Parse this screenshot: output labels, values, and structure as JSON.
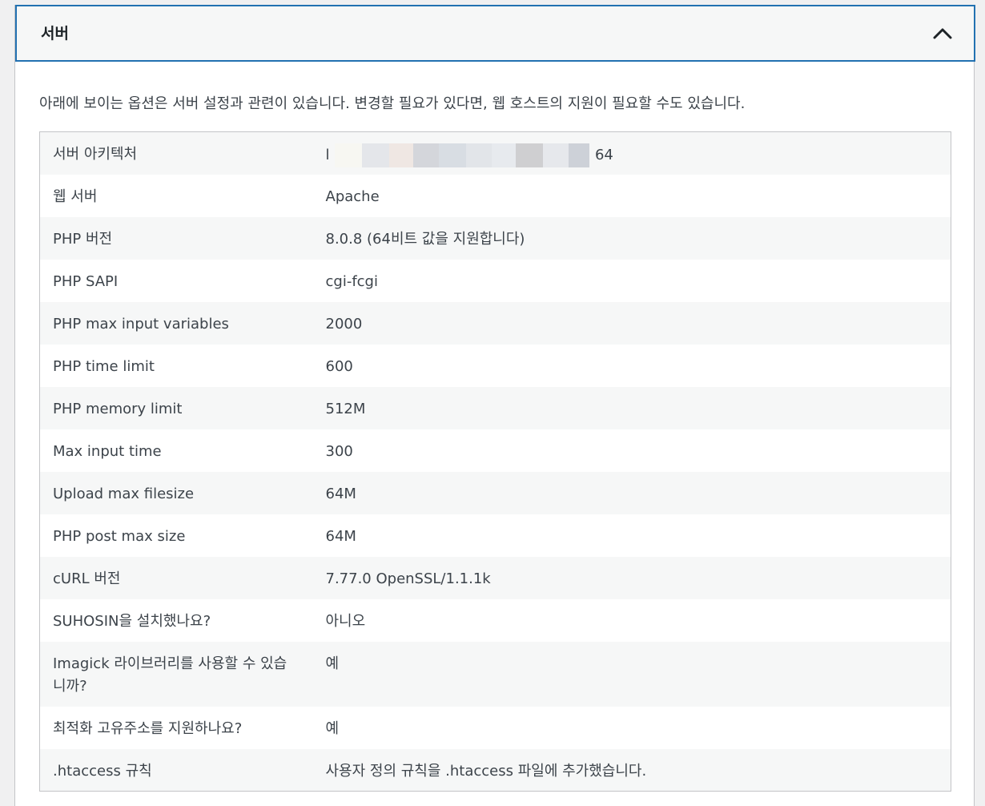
{
  "section": {
    "title": "서버",
    "description": "아래에 보이는 옵션은 서버 설정과 관련이 있습니다. 변경할 필요가 있다면, 웹 호스트의 지원이 필요할 수도 있습니다."
  },
  "rows": [
    {
      "label": "서버 아키텍처",
      "value_prefix": "l",
      "value_suffix": "64",
      "redacted": true
    },
    {
      "label": "웹 서버",
      "value": "Apache"
    },
    {
      "label": "PHP 버전",
      "value": "8.0.8 (64비트 값을 지원합니다)"
    },
    {
      "label": "PHP SAPI",
      "value": "cgi-fcgi"
    },
    {
      "label": "PHP max input variables",
      "value": "2000"
    },
    {
      "label": "PHP time limit",
      "value": "600"
    },
    {
      "label": "PHP memory limit",
      "value": "512M"
    },
    {
      "label": "Max input time",
      "value": "300"
    },
    {
      "label": "Upload max filesize",
      "value": "64M"
    },
    {
      "label": "PHP post max size",
      "value": "64M"
    },
    {
      "label": "cURL 버전",
      "value": "7.77.0 OpenSSL/1.1.1k"
    },
    {
      "label": "SUHOSIN을 설치했나요?",
      "value": "아니오"
    },
    {
      "label": "Imagick 라이브러리를 사용할 수 있습니까?",
      "value": "예"
    },
    {
      "label": "최적화 고유주소를 지원하나요?",
      "value": "예"
    },
    {
      "label": ".htaccess 규칙",
      "value": "사용자 정의 규칙을 .htaccess 파일에 추가했습니다."
    }
  ],
  "colors": {
    "accent": "#2271b1",
    "header_bg": "#f6f7f7",
    "row_alt_bg": "#f6f7f7",
    "text": "#3c434a"
  },
  "icons": {
    "collapse": "chevron-up-icon"
  }
}
